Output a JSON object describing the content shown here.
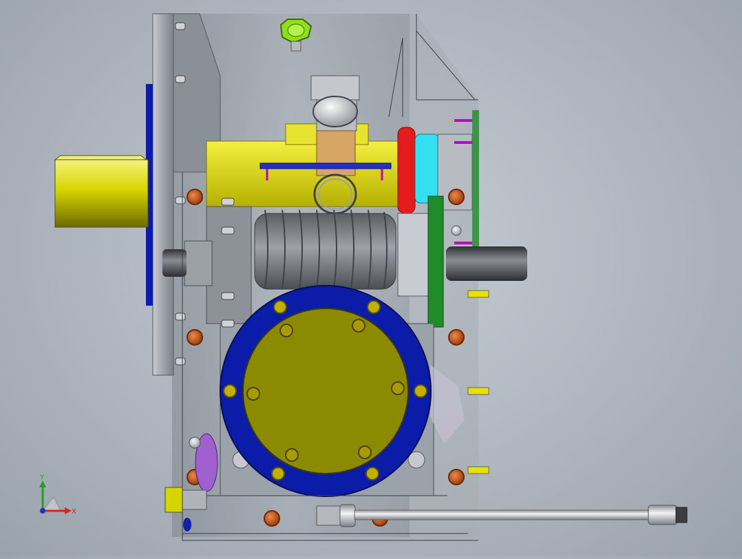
{
  "view": {
    "kind": "cad-assembly-viewport",
    "model": "worm-gear-reducer",
    "colors": {
      "background_center": "#c7ccd3",
      "background_edge": "#9aa2ac",
      "housing": "#9aa0a8",
      "output_shaft": "#d6d400",
      "inner_housing": "#e6e000",
      "cover_ring": "#0b1da8",
      "cover_plate": "#8c8a00",
      "worm": "#7a7f86",
      "seal_red": "#e51c1c",
      "seal_cyan": "#33e0f0",
      "seal_green": "#1f8c2a",
      "bolt_orange": "#c85a1a",
      "breather_green": "#8fe01a",
      "purple_part": "#a060d0",
      "magenta_pin": "#c000c0",
      "yellow_screw": "#e8e000"
    }
  },
  "triad": {
    "x_label": "X",
    "y_label": "Y",
    "x_color": "#e02020",
    "y_color": "#20a020",
    "z_color": "#2030c0"
  }
}
